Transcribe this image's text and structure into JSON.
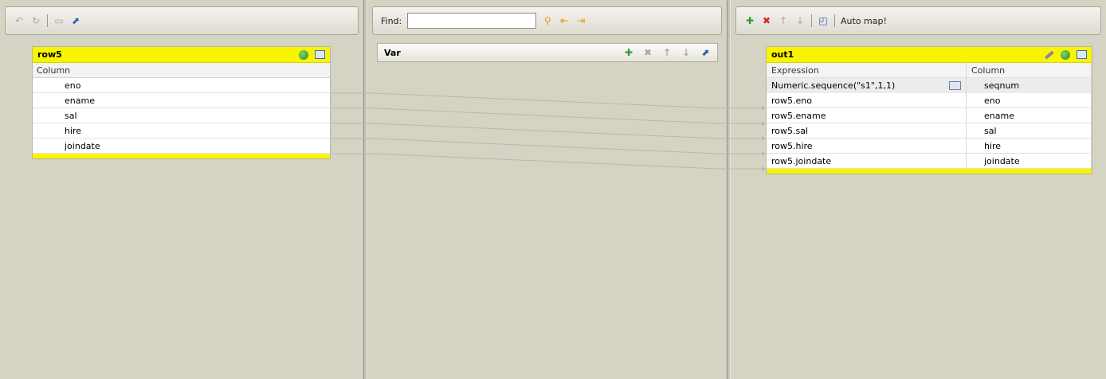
{
  "left_panel": {
    "input_table": {
      "title": "row5",
      "column_header": "Column",
      "rows": [
        "eno",
        "ename",
        "sal",
        "hire",
        "joindate"
      ]
    }
  },
  "middle_panel": {
    "find_label": "Find:",
    "find_value": "",
    "var_table": {
      "title": "Var"
    }
  },
  "right_panel": {
    "automap_label": "Auto map!",
    "output_table": {
      "title": "out1",
      "expression_header": "Expression",
      "column_header": "Column",
      "rows": [
        {
          "expression": "Numeric.sequence(\"s1\",1,1)",
          "column": "seqnum"
        },
        {
          "expression": "row5.eno",
          "column": "eno"
        },
        {
          "expression": "row5.ename",
          "column": "ename"
        },
        {
          "expression": "row5.sal",
          "column": "sal"
        },
        {
          "expression": "row5.hire",
          "column": "hire"
        },
        {
          "expression": "row5.joindate",
          "column": "joindate"
        }
      ]
    }
  },
  "colors": {
    "table_header": "#f7f500",
    "panel_bg": "#d5d4c4",
    "link_line": "#b9b7ab"
  }
}
